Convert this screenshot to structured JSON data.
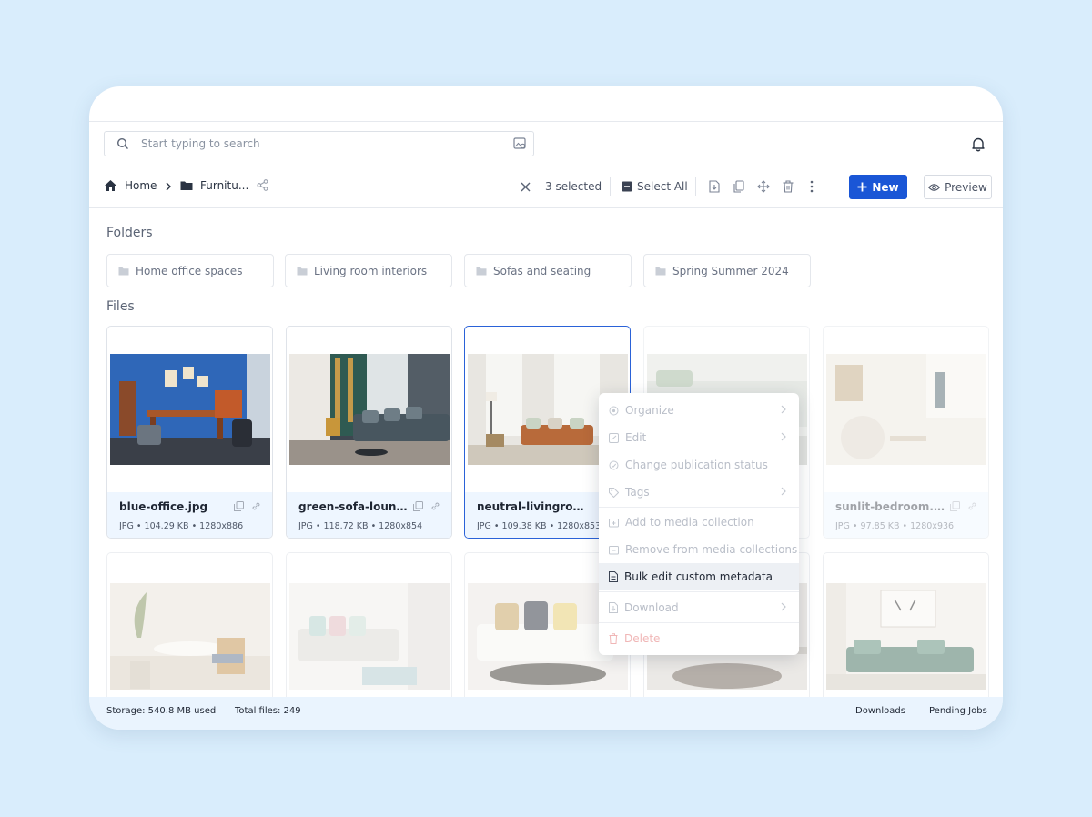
{
  "search": {
    "placeholder": "Start typing to search"
  },
  "breadcrumb": {
    "home": "Home",
    "folder": "Furnitu..."
  },
  "toolbar": {
    "selected_count": "3 selected",
    "select_all": "Select All",
    "new_label": "New",
    "preview_label": "Preview"
  },
  "folders_heading": "Folders",
  "folders": [
    {
      "name": "Home office spaces"
    },
    {
      "name": "Living room interiors"
    },
    {
      "name": "Sofas and seating"
    },
    {
      "name": "Spring Summer 2024"
    }
  ],
  "files_heading": "Files",
  "files": [
    {
      "name": "blue-office.jpg",
      "info": "JPG • 104.29 KB • 1280x886"
    },
    {
      "name": "green-sofa-lounge...",
      "info": "JPG • 118.72 KB • 1280x854"
    },
    {
      "name": "neutral-livingroom...",
      "info": "JPG • 109.38 KB • 1280x853"
    },
    {
      "name": "sunlit-bedroom.jpg",
      "info": "JPG • 97.85 KB • 1280x936"
    }
  ],
  "context_menu": {
    "organize": "Organize",
    "edit": "Edit",
    "change_status": "Change publication status",
    "tags": "Tags",
    "add_collection": "Add to media collection",
    "remove_collections": "Remove from media collections",
    "bulk_edit": "Bulk edit custom metadata",
    "download": "Download",
    "delete": "Delete"
  },
  "footer": {
    "storage": "Storage: 540.8 MB used",
    "total": "Total files: 249",
    "downloads": "Downloads",
    "pending": "Pending Jobs"
  },
  "colors": {
    "accent": "#1a56d6",
    "background": "#d9edfc",
    "footer": "#eaf4fe"
  }
}
